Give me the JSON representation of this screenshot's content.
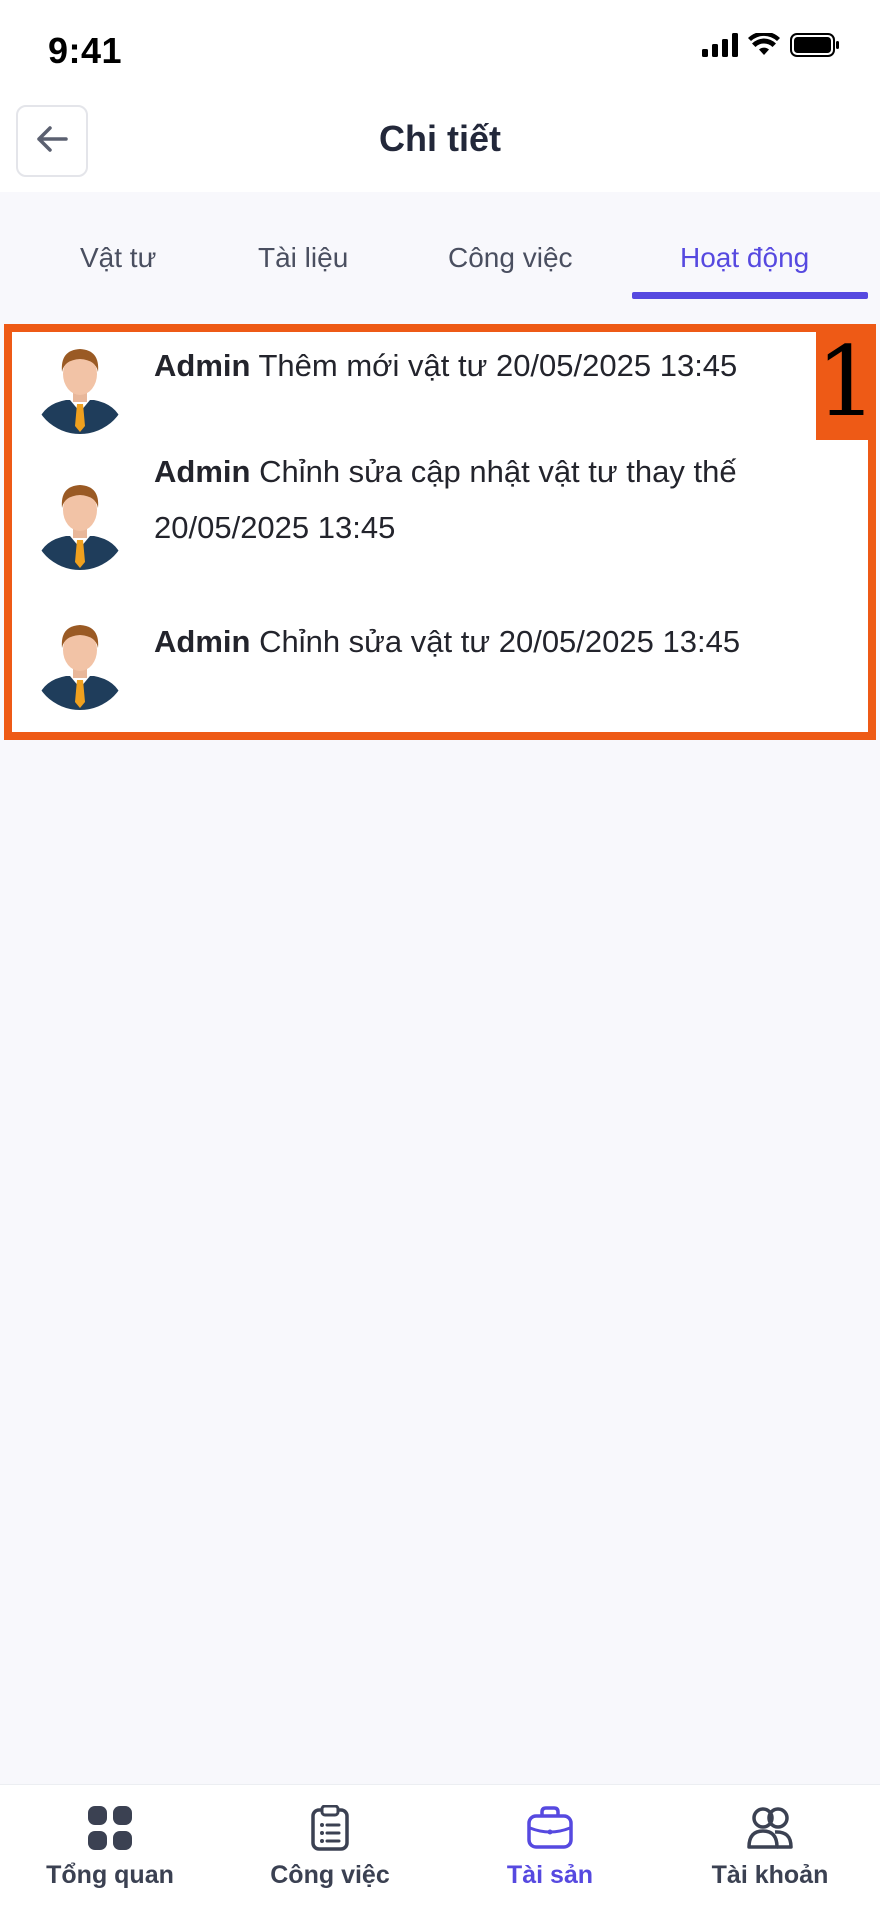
{
  "status_bar": {
    "time": "9:41"
  },
  "header": {
    "title": "Chi tiết"
  },
  "tabs": [
    {
      "label": "Vật tư",
      "active": false
    },
    {
      "label": "Tài liệu",
      "active": false
    },
    {
      "label": "Công việc",
      "active": false
    },
    {
      "label": "Hoạt động",
      "active": true
    }
  ],
  "activity": {
    "badge": "1",
    "items": [
      {
        "user": "Admin",
        "text": "Thêm mới vật tư 20/05/2025 13:45"
      },
      {
        "user": "Admin",
        "text": "Chỉnh sửa cập nhật vật tư thay thế 20/05/2025 13:45"
      },
      {
        "user": "Admin",
        "text": "Chỉnh sửa vật tư 20/05/2025 13:45"
      }
    ]
  },
  "bottom_nav": [
    {
      "label": "Tổng quan",
      "icon": "grid-icon",
      "active": false
    },
    {
      "label": "Công việc",
      "icon": "clipboard-list-icon",
      "active": false
    },
    {
      "label": "Tài sản",
      "icon": "briefcase-icon",
      "active": true
    },
    {
      "label": "Tài khoản",
      "icon": "users-icon",
      "active": false
    }
  ],
  "colors": {
    "accent": "#5649e0",
    "highlight": "#ee5a16",
    "text": "#23283a"
  }
}
